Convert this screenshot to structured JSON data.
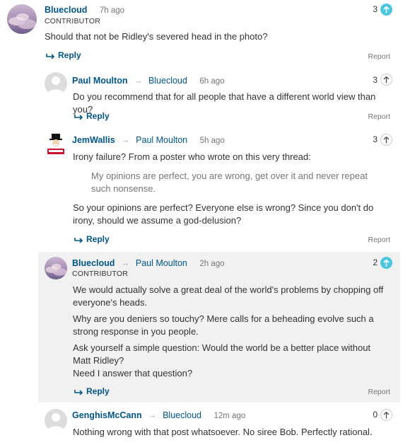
{
  "comments": [
    {
      "author": "Bluecloud",
      "reply_to": "",
      "time": "7h ago",
      "badge": "CONTRIBUTOR",
      "paragraphs": [
        "Should that not be Ridley's severed head in the photo?"
      ],
      "recommend_count": "3",
      "reply_label": "Reply",
      "report_label": "Report"
    },
    {
      "author": "Paul Moulton",
      "reply_to": "Bluecloud",
      "time": "6h ago",
      "paragraphs": [
        "Do you recommend that for all people that have a different world view than you?"
      ],
      "recommend_count": "3",
      "reply_label": "Reply",
      "report_label": "Report"
    },
    {
      "author": "JemWallis",
      "reply_to": "Paul Moulton",
      "time": "5h ago",
      "intro": "Irony failure? From a poster who wrote on this very thread:",
      "quote": "My opinions are perfect, you are wrong, get over it and never repeat such nonsense.",
      "outro": "So your opinions are perfect? Everyone else is wrong? Since you don't do irony, should we assume a god-delusion?",
      "recommend_count": "3",
      "reply_label": "Reply",
      "report_label": "Report"
    },
    {
      "author": "Bluecloud",
      "reply_to": "Paul Moulton",
      "time": "2h ago",
      "badge": "CONTRIBUTOR",
      "p1": "We would actually solve a great deal of the world's problems by chopping off everyone's heads.",
      "p2": "Why are you deniers so touchy? Mere calls for a beheading evolve such a strong response in you people.",
      "p3a": "Ask yourself a simple question: Would the world be a better place without Matt Ridley?",
      "p3b": "Need I answer that question?",
      "recommend_count": "2",
      "reply_label": "Reply",
      "report_label": "Report"
    },
    {
      "author": "GenghisMcCann",
      "reply_to": "Bluecloud",
      "time": "12m ago",
      "paragraphs": [
        "Nothing wrong with that post whatsoever. No siree Bob. Perfectly rational."
      ],
      "recommend_count": "0"
    }
  ],
  "colors": {
    "link": "#005689",
    "recommend_active": "#4bc6df",
    "highlight_bg": "#f1f1f1"
  },
  "icons": {
    "reply": "reply-arrow-icon",
    "recommend": "up-arrow-icon",
    "reply_to": "right-arrow-icon"
  }
}
